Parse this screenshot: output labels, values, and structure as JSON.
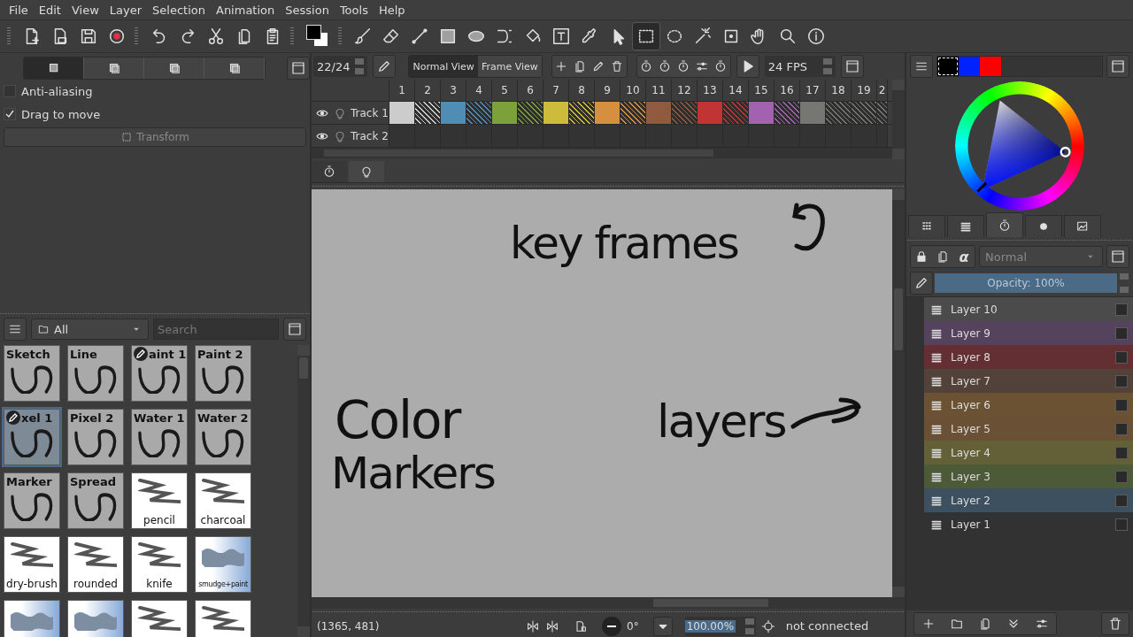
{
  "menu": [
    "File",
    "Edit",
    "View",
    "Layer",
    "Selection",
    "Animation",
    "Session",
    "Tools",
    "Help"
  ],
  "toolbar": {
    "tools": [
      {
        "kind": "new",
        "selected": false
      },
      {
        "kind": "open",
        "selected": false
      },
      {
        "kind": "save",
        "selected": false
      },
      {
        "kind": "record",
        "selected": false
      },
      {
        "kind": "undo",
        "selected": false
      },
      {
        "kind": "redo",
        "selected": false
      },
      {
        "kind": "cut",
        "selected": false
      },
      {
        "kind": "copy",
        "selected": false
      },
      {
        "kind": "paste",
        "selected": false
      },
      {
        "kind": "colors",
        "selected": false
      },
      {
        "kind": "brush",
        "selected": false
      },
      {
        "kind": "eraser",
        "selected": false
      },
      {
        "kind": "line",
        "selected": false
      },
      {
        "kind": "rect",
        "selected": false
      },
      {
        "kind": "ellipse",
        "selected": false
      },
      {
        "kind": "bezier",
        "selected": false
      },
      {
        "kind": "fill",
        "selected": false
      },
      {
        "kind": "text",
        "selected": false
      },
      {
        "kind": "picker",
        "selected": false
      },
      {
        "kind": "pointer",
        "selected": false
      },
      {
        "kind": "rectselect",
        "selected": true
      },
      {
        "kind": "ellipseselect",
        "selected": false
      },
      {
        "kind": "wand",
        "selected": false
      },
      {
        "kind": "transform",
        "selected": false
      },
      {
        "kind": "hand",
        "selected": false
      },
      {
        "kind": "zoom",
        "selected": false
      },
      {
        "kind": "info",
        "selected": false
      }
    ]
  },
  "tool_options": {
    "mode_tabs": [
      {
        "selected": true
      },
      {
        "selected": false
      },
      {
        "selected": false
      },
      {
        "selected": false
      }
    ],
    "options": [
      {
        "label": "Anti-aliasing",
        "checked": false
      },
      {
        "label": "Drag to move",
        "checked": true
      }
    ],
    "transform_button": {
      "label": "Transform",
      "disabled": true
    }
  },
  "presets": {
    "filter": "All",
    "search_placeholder": "Search",
    "items": [
      {
        "label": "Sketch",
        "kind": "gray",
        "modified": false,
        "selected": false
      },
      {
        "label": "Line",
        "kind": "gray",
        "modified": false,
        "selected": false
      },
      {
        "label": "aint 1",
        "kind": "gray",
        "modified": true,
        "selected": false
      },
      {
        "label": "Paint 2",
        "kind": "gray",
        "modified": false,
        "selected": false
      },
      {
        "label": "xel 1",
        "kind": "gray",
        "modified": true,
        "selected": true
      },
      {
        "label": "Pixel 2",
        "kind": "gray",
        "modified": false,
        "selected": false
      },
      {
        "label": "Water 1",
        "kind": "gray",
        "modified": false,
        "selected": false
      },
      {
        "label": "Water 2",
        "kind": "gray",
        "modified": false,
        "selected": false
      },
      {
        "label": "Marker",
        "kind": "gray",
        "modified": false,
        "selected": false
      },
      {
        "label": "Spread",
        "kind": "gray",
        "modified": false,
        "selected": false
      },
      {
        "label": "pencil",
        "kind": "white",
        "modified": false,
        "selected": false
      },
      {
        "label": "charcoal",
        "kind": "white",
        "modified": false,
        "selected": false
      },
      {
        "label": "dry-brush",
        "kind": "white",
        "modified": false,
        "selected": false
      },
      {
        "label": "rounded",
        "kind": "white",
        "modified": false,
        "selected": false
      },
      {
        "label": "knife",
        "kind": "white",
        "modified": false,
        "selected": false
      },
      {
        "label": "smudge+paint",
        "kind": "blue",
        "modified": false,
        "selected": false
      },
      {
        "kind": "blue",
        "modified": false,
        "selected": false
      },
      {
        "kind": "blue",
        "modified": false,
        "selected": false
      },
      {
        "kind": "white",
        "modified": false,
        "selected": false
      },
      {
        "kind": "white",
        "modified": false,
        "selected": false
      }
    ]
  },
  "timeline": {
    "frame": "22/24",
    "views": [
      {
        "label": "Normal View",
        "selected": true
      },
      {
        "label": "Frame View",
        "selected": false
      }
    ],
    "fps": "24 FPS",
    "columns": [
      "1",
      "2",
      "3",
      "4",
      "5",
      "6",
      "7",
      "8",
      "9",
      "10",
      "11",
      "12",
      "13",
      "14",
      "15",
      "16",
      "17",
      "18",
      "19",
      "2"
    ],
    "tracks": [
      {
        "name": "Track 1",
        "cells": [
          {
            "kind": "key",
            "color": "#cccccc"
          },
          {
            "kind": "hold",
            "color": "#cccccc"
          },
          {
            "kind": "key",
            "color": "#4f8db5"
          },
          {
            "kind": "hold",
            "color": "#4f8db5"
          },
          {
            "kind": "key",
            "color": "#7ca13a"
          },
          {
            "kind": "hold",
            "color": "#7ca13a"
          },
          {
            "kind": "key",
            "color": "#cdbb3b"
          },
          {
            "kind": "hold",
            "color": "#cdbb3b"
          },
          {
            "kind": "key",
            "color": "#d58f3f"
          },
          {
            "kind": "hold",
            "color": "#d58f3f"
          },
          {
            "kind": "key",
            "color": "#8f5a3d"
          },
          {
            "kind": "hold",
            "color": "#8f5a3d"
          },
          {
            "kind": "key",
            "color": "#c13434"
          },
          {
            "kind": "hold",
            "color": "#c13434"
          },
          {
            "kind": "key",
            "color": "#a262b0"
          },
          {
            "kind": "hold",
            "color": "#a262b0"
          },
          {
            "kind": "key",
            "color": "#767772"
          },
          {
            "kind": "hold",
            "color": "#767772"
          },
          {
            "kind": "hold",
            "color": "#767772"
          },
          {
            "kind": "hold",
            "color": "#767772"
          }
        ]
      },
      {
        "name": "Track 2"
      }
    ],
    "tabs": [
      {
        "selected": false
      },
      {
        "selected": true
      }
    ]
  },
  "canvas": {
    "notes": [
      "key frames",
      "Color",
      "Markers",
      "layers"
    ]
  },
  "status_bar": {
    "coords": "(1365, 481)",
    "rotation": "0°",
    "zoom": "100.00%",
    "connection": "not connected"
  },
  "palette": {
    "swatches": [
      {
        "color": "#000000",
        "selected": true
      },
      {
        "color": "#0022ff",
        "selected": false
      },
      {
        "color": "#ff0000",
        "selected": false
      }
    ]
  },
  "docker_tabs": [
    {
      "selected": false
    },
    {
      "selected": false
    },
    {
      "selected": true
    },
    {
      "selected": false
    },
    {
      "selected": false
    }
  ],
  "layers": {
    "blend_mode": "Normal",
    "alpha": "α",
    "opacity": {
      "label": "Opacity: 100%",
      "level": 1
    },
    "items": [
      {
        "name": "Layer 10",
        "color": "#4b4b4b",
        "checked": false
      },
      {
        "name": "Layer 9",
        "color": "#55435d",
        "checked": false
      },
      {
        "name": "Layer 8",
        "color": "#632f33",
        "checked": false
      },
      {
        "name": "Layer 7",
        "color": "#52423a",
        "checked": false
      },
      {
        "name": "Layer 6",
        "color": "#6b5233",
        "checked": false
      },
      {
        "name": "Layer 5",
        "color": "#6a5035",
        "checked": false
      },
      {
        "name": "Layer 4",
        "color": "#636038",
        "checked": false
      },
      {
        "name": "Layer 3",
        "color": "#4d5a38",
        "checked": false
      },
      {
        "name": "Layer 2",
        "color": "#3d5060",
        "checked": false
      },
      {
        "name": "Layer 1",
        "checked": false
      }
    ]
  }
}
